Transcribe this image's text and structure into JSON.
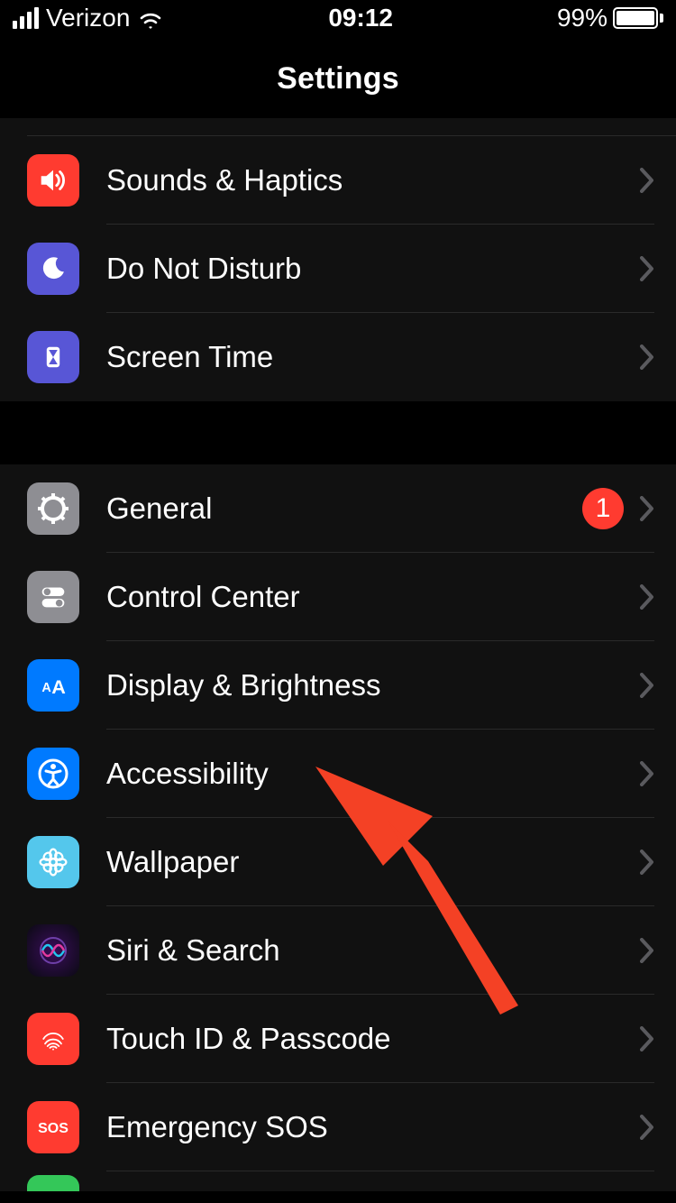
{
  "status_bar": {
    "carrier": "Verizon",
    "time": "09:12",
    "battery_pct": "99%"
  },
  "nav": {
    "title": "Settings"
  },
  "group1": {
    "items": [
      {
        "label": "Sounds & Haptics",
        "icon": "speaker-icon",
        "bg": "#ff3b30"
      },
      {
        "label": "Do Not Disturb",
        "icon": "moon-icon",
        "bg": "#5856d6"
      },
      {
        "label": "Screen Time",
        "icon": "hourglass-icon",
        "bg": "#5856d6"
      }
    ]
  },
  "group2": {
    "items": [
      {
        "label": "General",
        "icon": "gear-icon",
        "bg": "#8e8e93",
        "badge": "1"
      },
      {
        "label": "Control Center",
        "icon": "toggles-icon",
        "bg": "#8e8e93"
      },
      {
        "label": "Display & Brightness",
        "icon": "text-size-icon",
        "bg": "#007aff"
      },
      {
        "label": "Accessibility",
        "icon": "accessibility-icon",
        "bg": "#007aff"
      },
      {
        "label": "Wallpaper",
        "icon": "flower-icon",
        "bg": "#54c7ec"
      },
      {
        "label": "Siri & Search",
        "icon": "siri-icon",
        "bg": "#000000"
      },
      {
        "label": "Touch ID & Passcode",
        "icon": "fingerprint-icon",
        "bg": "#ff3b30"
      },
      {
        "label": "Emergency SOS",
        "icon": "sos-icon",
        "bg": "#ff3b30"
      }
    ]
  },
  "annotation": {
    "arrow_color": "#f44125"
  }
}
